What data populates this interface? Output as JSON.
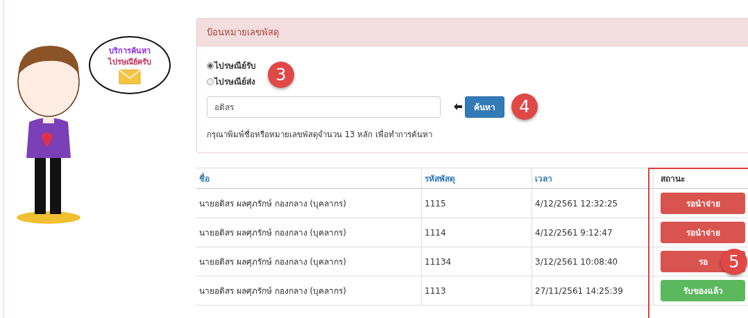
{
  "mascot": {
    "kind": "picture",
    "bubble": [
      "บริการค้นหา",
      "ไปรษณีย์ครับ"
    ]
  },
  "search_panel": {
    "title": "ป้อนหมายเลขพัสดุ",
    "radios": [
      {
        "label": "ไปรษณีย์รับ",
        "selected": true
      },
      {
        "label": "ไปรษณีย์ส่ง",
        "selected": false
      }
    ],
    "input": {
      "value": "อดิสร"
    },
    "button": "ค้นหา",
    "help": "กรุณาพิมพ์ชื่อหรือหมายเลขพัสดุจำนวน 13 หลัก เพื่อทำการค้นหา"
  },
  "table": {
    "columns": [
      {
        "label": "ชื่อ",
        "kind": "link"
      },
      {
        "label": "รหัสพัสดุ",
        "kind": "link"
      },
      {
        "label": "เวลา",
        "kind": "link"
      },
      {
        "label": "สถานะ",
        "kind": "plain"
      }
    ],
    "rows": [
      {
        "name": "นายอดิสร ผลศุภรักษ์ กองกลาง (บุคลากร)",
        "code": "1115",
        "time": "4/12/2561 12:32:25",
        "status": {
          "label": "รอนำจ่าย",
          "kind": "waiting"
        }
      },
      {
        "name": "นายอดิสร ผลศุภรักษ์ กองกลาง (บุคลากร)",
        "code": "1114",
        "time": "4/12/2561 9:12:47",
        "status": {
          "label": "รอนำจ่าย",
          "kind": "waiting"
        }
      },
      {
        "name": "นายอดิสร ผลศุภรักษ์ กองกลาง (บุคลากร)",
        "code": "11134",
        "time": "3/12/2561 10:08:40",
        "status": {
          "label": "รอ",
          "kind": "waiting"
        }
      },
      {
        "name": "นายอดิสร ผลศุภรักษ์ กองกลาง (บุคลากร)",
        "code": "1113",
        "time": "27/11/2561 14:25:39",
        "status": {
          "label": "รับของแล้ว",
          "kind": "received"
        }
      }
    ]
  },
  "annotations": [
    "3",
    "4",
    "5"
  ]
}
